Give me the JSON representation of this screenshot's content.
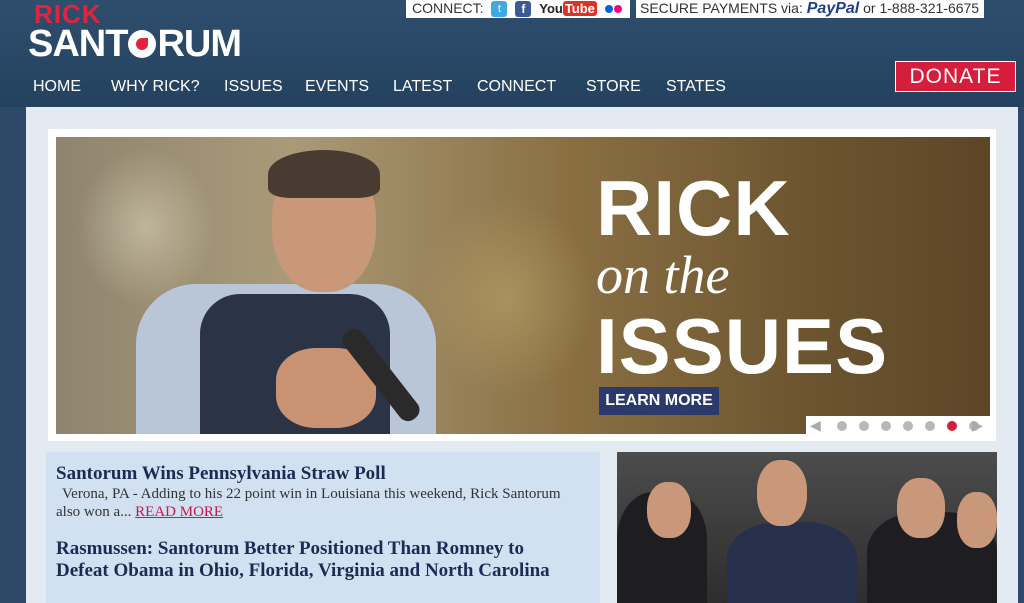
{
  "logo": {
    "top": "RICK",
    "main_left": "SANT",
    "main_right": "RUM"
  },
  "connect": {
    "label": "CONNECT:",
    "icons": [
      "twitter-icon",
      "facebook-icon",
      "youtube-icon",
      "flickr-icon"
    ],
    "youtube_a": "You",
    "youtube_b": "Tube"
  },
  "secure": {
    "label": "SECURE PAYMENTS via:",
    "paypal": "PayPal",
    "phone": "or 1-888-321-6675"
  },
  "nav": [
    "HOME",
    "WHY RICK?",
    "ISSUES",
    "EVENTS",
    "LATEST",
    "CONNECT",
    "STORE",
    "STATES"
  ],
  "donate": "DONATE",
  "hero": {
    "line1": "RICK",
    "line2": "on the",
    "line3": "ISSUES",
    "cta": "LEARN MORE",
    "slides": 7,
    "active_slide": 6,
    "prev": "◀",
    "next": "▶"
  },
  "news": [
    {
      "title": "Santorum Wins Pennsylvania Straw Poll",
      "excerpt": "Verona, PA - Adding to his 22 point win in Louisiana this weekend, Rick Santorum also won a...",
      "read_more": "READ MORE"
    },
    {
      "title": "Rasmussen: Santorum Better Positioned Than Romney to Defeat Obama in Ohio, Florida, Virginia and North Carolina"
    }
  ],
  "colors": {
    "brand_red": "#d51d3c",
    "navy": "#2c4a68",
    "paypal_blue": "#1e3f8a"
  }
}
